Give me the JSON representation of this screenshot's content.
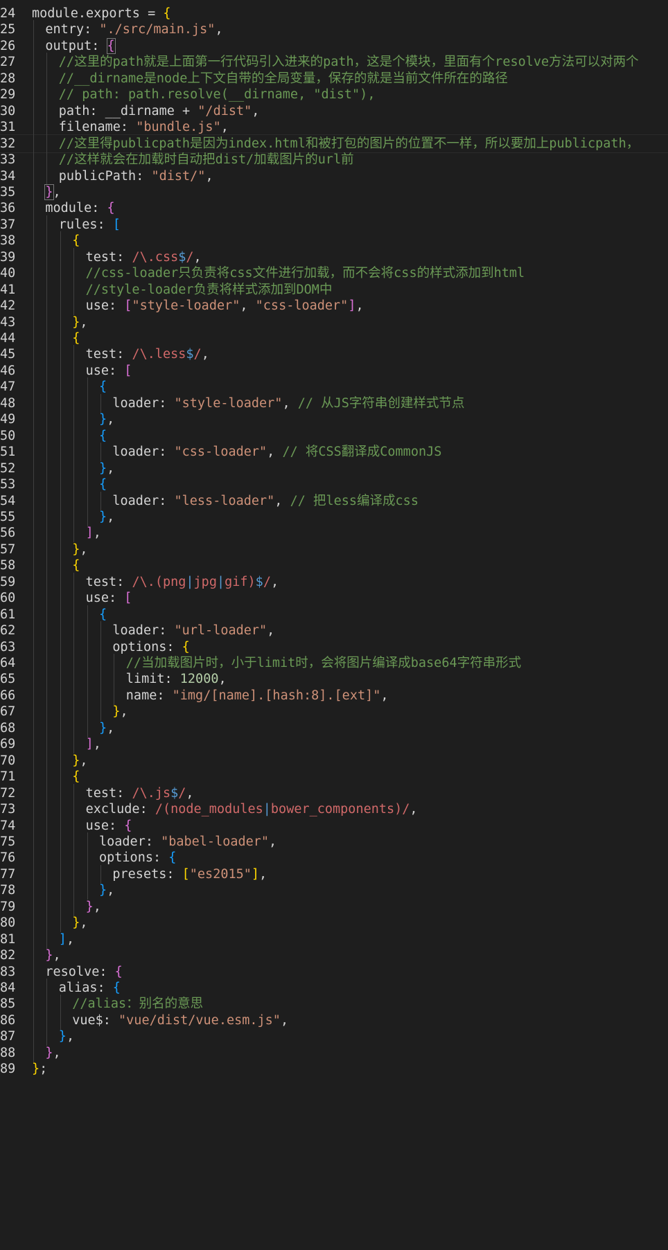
{
  "editor": {
    "language": "javascript",
    "current_line": 32,
    "colors": {
      "background": "#1e1e1e",
      "text": "#d4d4d4",
      "string": "#ce9178",
      "comment": "#6a9955",
      "number": "#b5cea8",
      "regex": "#d16969",
      "regex_operator": "#569cd6",
      "bracket_level_1": "#ffd700",
      "bracket_level_2": "#da70d6",
      "bracket_level_3": "#179fff"
    },
    "lines": [
      {
        "n": "24",
        "indent": 0,
        "tokens": [
          [
            "p",
            "module.exports = "
          ],
          [
            "b1",
            "{"
          ]
        ]
      },
      {
        "n": "25",
        "indent": 1,
        "tokens": [
          [
            "k",
            "entry"
          ],
          [
            "p",
            ": "
          ],
          [
            "s",
            "\"./src/main.js\""
          ],
          [
            "p",
            ","
          ]
        ]
      },
      {
        "n": "26",
        "indent": 1,
        "tokens": [
          [
            "k",
            "output"
          ],
          [
            "p",
            ": "
          ],
          [
            "b2box",
            "{"
          ]
        ]
      },
      {
        "n": "27",
        "indent": 2,
        "tokens": [
          [
            "c",
            "//这里的path就是上面第一行代码引入进来的path，这是个模块，里面有个resolve方法可以对两个"
          ]
        ]
      },
      {
        "n": "28",
        "indent": 2,
        "tokens": [
          [
            "c",
            "//__dirname是node上下文自带的全局变量，保存的就是当前文件所在的路径"
          ]
        ]
      },
      {
        "n": "29",
        "indent": 2,
        "tokens": [
          [
            "c",
            "// path: path.resolve(__dirname, \"dist\"),"
          ]
        ]
      },
      {
        "n": "30",
        "indent": 2,
        "tokens": [
          [
            "k",
            "path"
          ],
          [
            "p",
            ": __dirname + "
          ],
          [
            "s",
            "\"/dist\""
          ],
          [
            "p",
            ","
          ]
        ]
      },
      {
        "n": "31",
        "indent": 2,
        "tokens": [
          [
            "k",
            "filename"
          ],
          [
            "p",
            ": "
          ],
          [
            "s",
            "\"bundle.js\""
          ],
          [
            "p",
            ","
          ]
        ]
      },
      {
        "n": "32",
        "indent": 2,
        "tokens": [
          [
            "c",
            "//这里得publicpath是因为index.html和被打包的图片的位置不一样，所以要加上publicpath，"
          ]
        ]
      },
      {
        "n": "33",
        "indent": 2,
        "tokens": [
          [
            "c",
            "//这样就会在加载时自动把dist/加载图片的url前"
          ]
        ]
      },
      {
        "n": "34",
        "indent": 2,
        "tokens": [
          [
            "k",
            "publicPath"
          ],
          [
            "p",
            ": "
          ],
          [
            "s",
            "\"dist/\""
          ],
          [
            "p",
            ","
          ]
        ]
      },
      {
        "n": "35",
        "indent": 1,
        "tokens": [
          [
            "b2box",
            "}"
          ],
          [
            "p",
            ","
          ]
        ]
      },
      {
        "n": "36",
        "indent": 1,
        "tokens": [
          [
            "k",
            "module"
          ],
          [
            "p",
            ": "
          ],
          [
            "b2",
            "{"
          ]
        ]
      },
      {
        "n": "37",
        "indent": 2,
        "tokens": [
          [
            "k",
            "rules"
          ],
          [
            "p",
            ": "
          ],
          [
            "b3",
            "["
          ]
        ]
      },
      {
        "n": "38",
        "indent": 3,
        "tokens": [
          [
            "b1",
            "{"
          ]
        ]
      },
      {
        "n": "39",
        "indent": 4,
        "tokens": [
          [
            "k",
            "test"
          ],
          [
            "p",
            ": "
          ],
          [
            "r",
            "/\\.css"
          ],
          [
            "ro",
            "$"
          ],
          [
            "r",
            "/"
          ],
          [
            "p",
            ","
          ]
        ]
      },
      {
        "n": "40",
        "indent": 4,
        "tokens": [
          [
            "c",
            "//css-loader只负责将css文件进行加载，而不会将css的样式添加到html"
          ]
        ]
      },
      {
        "n": "41",
        "indent": 4,
        "tokens": [
          [
            "c",
            "//style-loader负责将样式添加到DOM中"
          ]
        ]
      },
      {
        "n": "42",
        "indent": 4,
        "tokens": [
          [
            "k",
            "use"
          ],
          [
            "p",
            ": "
          ],
          [
            "b2",
            "["
          ],
          [
            "s",
            "\"style-loader\""
          ],
          [
            "p",
            ", "
          ],
          [
            "s",
            "\"css-loader\""
          ],
          [
            "b2",
            "]"
          ],
          [
            "p",
            ","
          ]
        ]
      },
      {
        "n": "43",
        "indent": 3,
        "tokens": [
          [
            "b1",
            "}"
          ],
          [
            "p",
            ","
          ]
        ]
      },
      {
        "n": "44",
        "indent": 3,
        "tokens": [
          [
            "b1",
            "{"
          ]
        ]
      },
      {
        "n": "45",
        "indent": 4,
        "tokens": [
          [
            "k",
            "test"
          ],
          [
            "p",
            ": "
          ],
          [
            "r",
            "/\\.less"
          ],
          [
            "ro",
            "$"
          ],
          [
            "r",
            "/"
          ],
          [
            "p",
            ","
          ]
        ]
      },
      {
        "n": "46",
        "indent": 4,
        "tokens": [
          [
            "k",
            "use"
          ],
          [
            "p",
            ": "
          ],
          [
            "b2",
            "["
          ]
        ]
      },
      {
        "n": "47",
        "indent": 5,
        "tokens": [
          [
            "b3",
            "{"
          ]
        ]
      },
      {
        "n": "48",
        "indent": 6,
        "tokens": [
          [
            "k",
            "loader"
          ],
          [
            "p",
            ": "
          ],
          [
            "s",
            "\"style-loader\""
          ],
          [
            "p",
            ", "
          ],
          [
            "c",
            "// 从JS字符串创建样式节点"
          ]
        ]
      },
      {
        "n": "49",
        "indent": 5,
        "tokens": [
          [
            "b3",
            "}"
          ],
          [
            "p",
            ","
          ]
        ]
      },
      {
        "n": "50",
        "indent": 5,
        "tokens": [
          [
            "b3",
            "{"
          ]
        ]
      },
      {
        "n": "51",
        "indent": 6,
        "tokens": [
          [
            "k",
            "loader"
          ],
          [
            "p",
            ": "
          ],
          [
            "s",
            "\"css-loader\""
          ],
          [
            "p",
            ", "
          ],
          [
            "c",
            "// 将CSS翻译成CommonJS"
          ]
        ]
      },
      {
        "n": "52",
        "indent": 5,
        "tokens": [
          [
            "b3",
            "}"
          ],
          [
            "p",
            ","
          ]
        ]
      },
      {
        "n": "53",
        "indent": 5,
        "tokens": [
          [
            "b3",
            "{"
          ]
        ]
      },
      {
        "n": "54",
        "indent": 6,
        "tokens": [
          [
            "k",
            "loader"
          ],
          [
            "p",
            ": "
          ],
          [
            "s",
            "\"less-loader\""
          ],
          [
            "p",
            ", "
          ],
          [
            "c",
            "// 把less编译成css"
          ]
        ]
      },
      {
        "n": "55",
        "indent": 5,
        "tokens": [
          [
            "b3",
            "}"
          ],
          [
            "p",
            ","
          ]
        ]
      },
      {
        "n": "56",
        "indent": 4,
        "tokens": [
          [
            "b2",
            "]"
          ],
          [
            "p",
            ","
          ]
        ]
      },
      {
        "n": "57",
        "indent": 3,
        "tokens": [
          [
            "b1",
            "}"
          ],
          [
            "p",
            ","
          ]
        ]
      },
      {
        "n": "58",
        "indent": 3,
        "tokens": [
          [
            "b1",
            "{"
          ]
        ]
      },
      {
        "n": "59",
        "indent": 4,
        "tokens": [
          [
            "k",
            "test"
          ],
          [
            "p",
            ": "
          ],
          [
            "r",
            "/\\.(png"
          ],
          [
            "ro",
            "|"
          ],
          [
            "r",
            "jpg"
          ],
          [
            "ro",
            "|"
          ],
          [
            "r",
            "gif)"
          ],
          [
            "ro",
            "$"
          ],
          [
            "r",
            "/"
          ],
          [
            "p",
            ","
          ]
        ]
      },
      {
        "n": "60",
        "indent": 4,
        "tokens": [
          [
            "k",
            "use"
          ],
          [
            "p",
            ": "
          ],
          [
            "b2",
            "["
          ]
        ]
      },
      {
        "n": "61",
        "indent": 5,
        "tokens": [
          [
            "b3",
            "{"
          ]
        ]
      },
      {
        "n": "62",
        "indent": 6,
        "tokens": [
          [
            "k",
            "loader"
          ],
          [
            "p",
            ": "
          ],
          [
            "s",
            "\"url-loader\""
          ],
          [
            "p",
            ","
          ]
        ]
      },
      {
        "n": "63",
        "indent": 6,
        "tokens": [
          [
            "k",
            "options"
          ],
          [
            "p",
            ": "
          ],
          [
            "b1",
            "{"
          ]
        ]
      },
      {
        "n": "64",
        "indent": 7,
        "tokens": [
          [
            "c",
            "//当加载图片时，小于limit时，会将图片编译成base64字符串形式"
          ]
        ]
      },
      {
        "n": "65",
        "indent": 7,
        "tokens": [
          [
            "k",
            "limit"
          ],
          [
            "p",
            ": "
          ],
          [
            "n",
            "12000"
          ],
          [
            "p",
            ","
          ]
        ]
      },
      {
        "n": "66",
        "indent": 7,
        "tokens": [
          [
            "k",
            "name"
          ],
          [
            "p",
            ": "
          ],
          [
            "s",
            "\"img/[name].[hash:8].[ext]\""
          ],
          [
            "p",
            ","
          ]
        ]
      },
      {
        "n": "67",
        "indent": 6,
        "tokens": [
          [
            "b1",
            "}"
          ],
          [
            "p",
            ","
          ]
        ]
      },
      {
        "n": "68",
        "indent": 5,
        "tokens": [
          [
            "b3",
            "}"
          ],
          [
            "p",
            ","
          ]
        ]
      },
      {
        "n": "69",
        "indent": 4,
        "tokens": [
          [
            "b2",
            "]"
          ],
          [
            "p",
            ","
          ]
        ]
      },
      {
        "n": "70",
        "indent": 3,
        "tokens": [
          [
            "b1",
            "}"
          ],
          [
            "p",
            ","
          ]
        ]
      },
      {
        "n": "71",
        "indent": 3,
        "tokens": [
          [
            "b1",
            "{"
          ]
        ]
      },
      {
        "n": "72",
        "indent": 4,
        "tokens": [
          [
            "k",
            "test"
          ],
          [
            "p",
            ": "
          ],
          [
            "r",
            "/\\.js"
          ],
          [
            "ro",
            "$"
          ],
          [
            "r",
            "/"
          ],
          [
            "p",
            ","
          ]
        ]
      },
      {
        "n": "73",
        "indent": 4,
        "tokens": [
          [
            "k",
            "exclude"
          ],
          [
            "p",
            ": "
          ],
          [
            "r",
            "/(node_modules"
          ],
          [
            "ro",
            "|"
          ],
          [
            "r",
            "bower_components)/"
          ],
          [
            "p",
            ","
          ]
        ]
      },
      {
        "n": "74",
        "indent": 4,
        "tokens": [
          [
            "k",
            "use"
          ],
          [
            "p",
            ": "
          ],
          [
            "b2",
            "{"
          ]
        ]
      },
      {
        "n": "75",
        "indent": 5,
        "tokens": [
          [
            "k",
            "loader"
          ],
          [
            "p",
            ": "
          ],
          [
            "s",
            "\"babel-loader\""
          ],
          [
            "p",
            ","
          ]
        ]
      },
      {
        "n": "76",
        "indent": 5,
        "tokens": [
          [
            "k",
            "options"
          ],
          [
            "p",
            ": "
          ],
          [
            "b3",
            "{"
          ]
        ]
      },
      {
        "n": "77",
        "indent": 6,
        "tokens": [
          [
            "k",
            "presets"
          ],
          [
            "p",
            ": "
          ],
          [
            "b1",
            "["
          ],
          [
            "s",
            "\"es2015\""
          ],
          [
            "b1",
            "]"
          ],
          [
            "p",
            ","
          ]
        ]
      },
      {
        "n": "78",
        "indent": 5,
        "tokens": [
          [
            "b3",
            "}"
          ],
          [
            "p",
            ","
          ]
        ]
      },
      {
        "n": "79",
        "indent": 4,
        "tokens": [
          [
            "b2",
            "}"
          ],
          [
            "p",
            ","
          ]
        ]
      },
      {
        "n": "80",
        "indent": 3,
        "tokens": [
          [
            "b1",
            "}"
          ],
          [
            "p",
            ","
          ]
        ]
      },
      {
        "n": "81",
        "indent": 2,
        "tokens": [
          [
            "b3",
            "]"
          ],
          [
            "p",
            ","
          ]
        ]
      },
      {
        "n": "82",
        "indent": 1,
        "tokens": [
          [
            "b2",
            "}"
          ],
          [
            "p",
            ","
          ]
        ]
      },
      {
        "n": "83",
        "indent": 1,
        "tokens": [
          [
            "k",
            "resolve"
          ],
          [
            "p",
            ": "
          ],
          [
            "b2",
            "{"
          ]
        ]
      },
      {
        "n": "84",
        "indent": 2,
        "tokens": [
          [
            "k",
            "alias"
          ],
          [
            "p",
            ": "
          ],
          [
            "b3",
            "{"
          ]
        ]
      },
      {
        "n": "85",
        "indent": 3,
        "tokens": [
          [
            "c",
            "//alias：别名的意思"
          ]
        ]
      },
      {
        "n": "86",
        "indent": 3,
        "tokens": [
          [
            "k",
            "vue$"
          ],
          [
            "p",
            ": "
          ],
          [
            "s",
            "\"vue/dist/vue.esm.js\""
          ],
          [
            "p",
            ","
          ]
        ]
      },
      {
        "n": "87",
        "indent": 2,
        "tokens": [
          [
            "b3",
            "}"
          ],
          [
            "p",
            ","
          ]
        ]
      },
      {
        "n": "88",
        "indent": 1,
        "tokens": [
          [
            "b2",
            "}"
          ],
          [
            "p",
            ","
          ]
        ]
      },
      {
        "n": "89",
        "indent": 0,
        "tokens": [
          [
            "b1",
            "}"
          ],
          [
            "p",
            ";"
          ]
        ]
      }
    ]
  }
}
